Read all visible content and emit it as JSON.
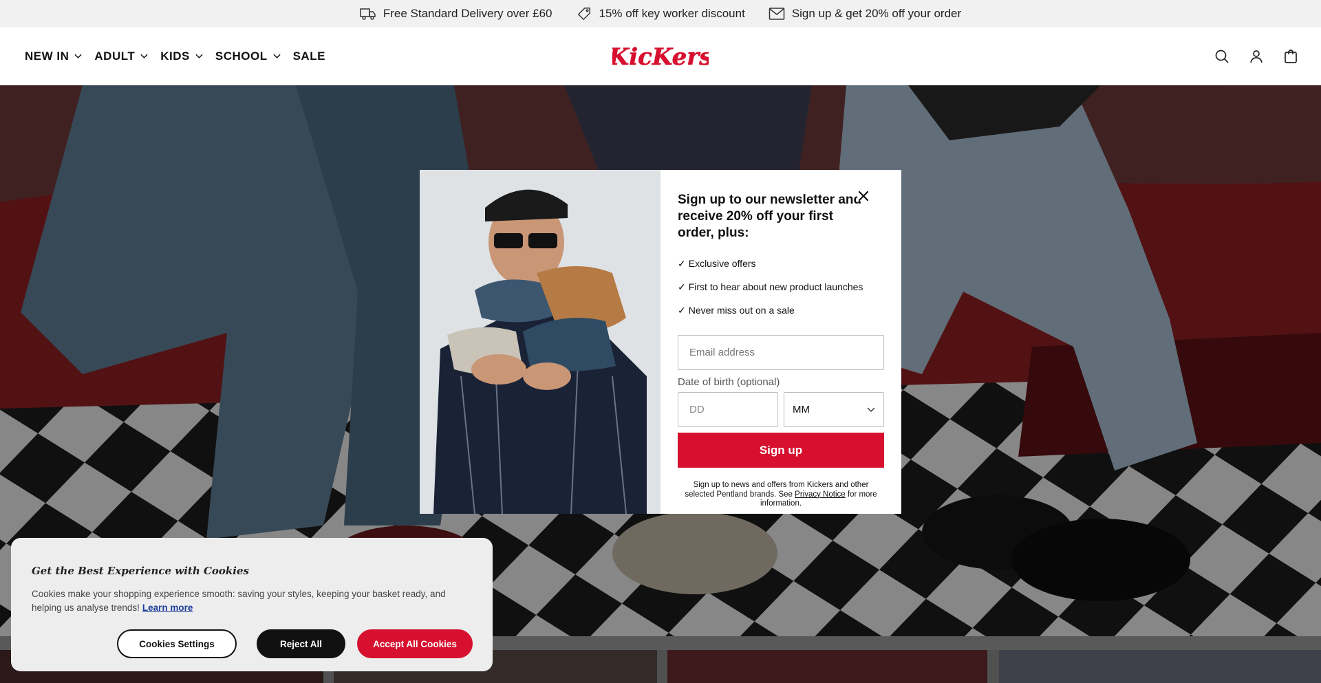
{
  "announcement": {
    "items": [
      {
        "icon": "truck-icon",
        "text": "Free Standard Delivery over £60"
      },
      {
        "icon": "tag-icon",
        "text": "15% off key worker discount"
      },
      {
        "icon": "mail-icon",
        "text": "Sign up & get 20% off your order"
      }
    ]
  },
  "header": {
    "nav": [
      {
        "label": "NEW IN",
        "has_dropdown": true
      },
      {
        "label": "ADULT",
        "has_dropdown": true
      },
      {
        "label": "KIDS",
        "has_dropdown": true
      },
      {
        "label": "SCHOOL",
        "has_dropdown": true
      },
      {
        "label": "SALE",
        "has_dropdown": false
      }
    ],
    "logo_text": "KicKers",
    "icons": [
      "search-icon",
      "account-icon",
      "bag-icon"
    ]
  },
  "modal": {
    "heading": "Sign up to our newsletter and receive 20% off your first order, plus:",
    "benefits": [
      {
        "check": "✓",
        "text": "Exclusive offers"
      },
      {
        "check": "✓",
        "text": "First to hear about new product launches"
      },
      {
        "check": "✓",
        "text": "Never miss out on a sale"
      }
    ],
    "email_placeholder": "Email address",
    "dob_label": "Date of birth (optional)",
    "dd_placeholder": "DD",
    "mm_value": "MM",
    "signup_label": "Sign up",
    "disclaimer_before": "Sign up to news and offers from Kickers and other selected Pentland brands. See ",
    "disclaimer_link": "Privacy Notice",
    "disclaimer_after": " for more information."
  },
  "cookie": {
    "title": "Get the Best Experience with Cookies",
    "text": "Cookies make your shopping experience smooth: saving your styles, keeping your basket ready, and helping us analyse trends!",
    "learn_more": "Learn more",
    "settings_label": "Cookies Settings",
    "reject_label": "Reject All",
    "accept_label": "Accept All Cookies"
  },
  "colors": {
    "brand_red": "#d6102e",
    "cookie_link_blue": "#1d3f9c"
  }
}
